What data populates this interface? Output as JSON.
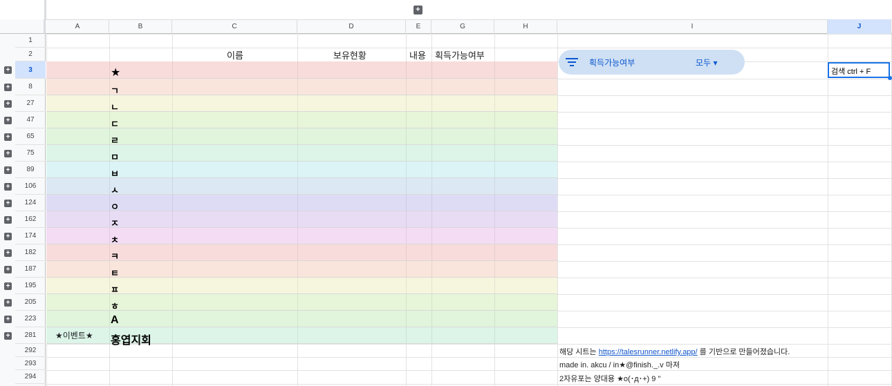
{
  "top_expand_symbol": "+",
  "columns": [
    "A",
    "B",
    "C",
    "D",
    "E",
    "G",
    "H",
    "I",
    "J"
  ],
  "selected_column": "J",
  "rows": [
    "1",
    "2",
    "3",
    "8",
    "27",
    "47",
    "65",
    "75",
    "89",
    "106",
    "124",
    "162",
    "174",
    "182",
    "187",
    "195",
    "205",
    "223",
    "281",
    "292",
    "293",
    "294"
  ],
  "selected_row": "3",
  "expand_symbol": "+",
  "header_row": {
    "name": "이름",
    "holding": "보유현황",
    "content": "내용",
    "obtainable": "획득가능여부"
  },
  "section_letters": [
    "★",
    "ㄱ",
    "ㄴ",
    "ㄷ",
    "ㄹ",
    "ㅁ",
    "ㅂ",
    "ㅅ",
    "ㅇ",
    "ㅈ",
    "ㅊ",
    "ㅋ",
    "ㅌ",
    "ㅍ",
    "ㅎ",
    "A",
    "홍엽지회"
  ],
  "event_label": "★이벤트★",
  "band_colors": [
    "#f8dcdc",
    "#f9e5dc",
    "#f6f5de",
    "#e7f5d9",
    "#e0f5dc",
    "#dcf5e8",
    "#dcf4f5",
    "#dde8f5",
    "#dedcf5",
    "#e8dcf5",
    "#f4dcf4",
    "#f8dcdc",
    "#f9e5dc",
    "#f6f5de",
    "#e7f5d9",
    "#e0f5dc",
    "#dcf5e8"
  ],
  "filter": {
    "label": "획득가능여부",
    "value": "모두",
    "caret": "▾",
    "icon": "filter-lines-icon"
  },
  "active_cell": {
    "value": "검색 ctrl + F"
  },
  "notes": {
    "line1_prefix": "해당 시트는 ",
    "line1_link": "https://talesrunner.netlify.app/",
    "line1_suffix": " 를 기반으로 만들어졌습니다.",
    "line2": "made in. akcu / in★@finish._.v  마져",
    "line3": "2자유포는 양대용 ★o(･д･+) 9 \""
  },
  "colors": {
    "accent": "#1a73e8",
    "filter_chip": "#cfe0f4",
    "header_bg": "#f8f9fa",
    "selected_header": "#d3e3fd"
  }
}
